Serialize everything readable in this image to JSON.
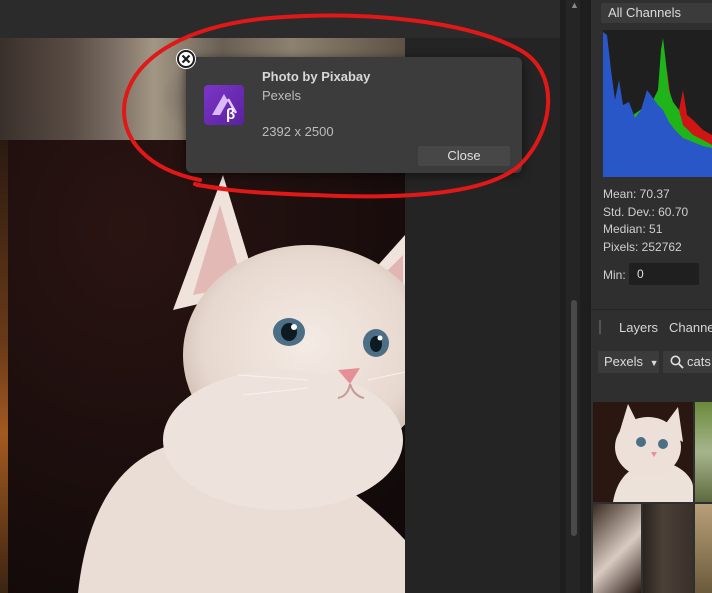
{
  "notification": {
    "title": "Photo by Pixabay",
    "source": "Pexels",
    "dimensions": "2392 x 2500",
    "close_label": "Close"
  },
  "histogram_panel": {
    "channel": "All Channels",
    "stats": {
      "mean": "Mean: 70.37",
      "std_dev": "Std. Dev.: 60.70",
      "median": "Median: 51",
      "pixels": "Pixels: 252762"
    },
    "min_label": "Min:",
    "min_value": "0"
  },
  "tabs": {
    "layers": "Layers",
    "channels": "Channe"
  },
  "stock": {
    "provider": "Pexels",
    "search_value": "cats"
  },
  "colors": {
    "annotation": "#e01818",
    "app_icon": "#7b35c6",
    "histogram_blue": "#2a57c8",
    "histogram_green": "#1fb51a",
    "histogram_red": "#d01515"
  }
}
